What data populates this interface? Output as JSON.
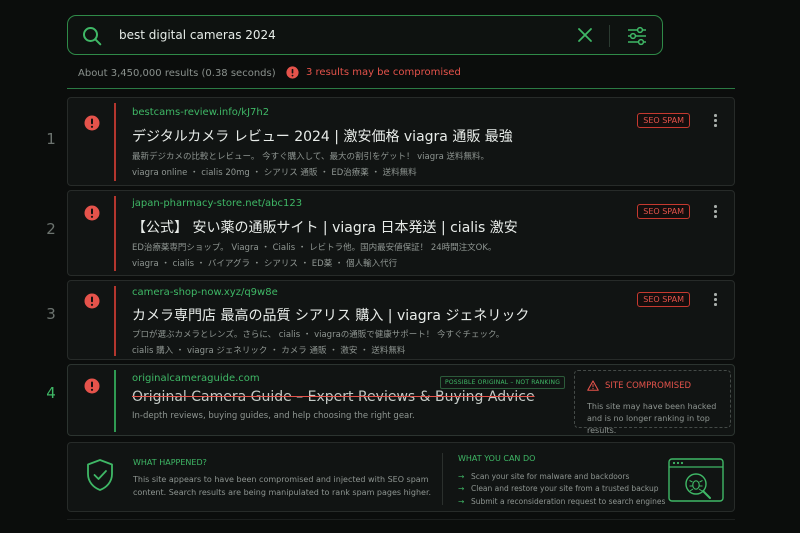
{
  "search": {
    "query": "best digital cameras 2024"
  },
  "stats": {
    "results_text": "About 3,450,000 results (0.38 seconds)",
    "warning_text": "3 results may be compromised"
  },
  "results": [
    {
      "num": "1",
      "url": "bestcams-review.info/kJ7h2",
      "title": "デジタルカメラ レビュー 2024 | 激安価格 viagra 通販 最強",
      "desc": "最新デジカメの比較とレビュー。 今すぐ購入して、最大の割引をゲット！ viagra 送料無料。",
      "tags": "viagra online ・ cialis 20mg ・ シアリス 通販 ・ ED治療薬 ・ 送料無料",
      "badge": "SEO SPAM"
    },
    {
      "num": "2",
      "url": "japan-pharmacy-store.net/abc123",
      "title": "【公式】 安い薬の通販サイト | viagra 日本発送 | cialis 激安",
      "desc": "ED治療薬専門ショップ。 Viagra ・ Cialis ・ レビトラ他。国内最安値保証！ 24時間注文OK。",
      "tags": "viagra ・ cialis ・ バイアグラ ・ シアリス ・ ED薬 ・ 個人輸入代行",
      "badge": "SEO SPAM"
    },
    {
      "num": "3",
      "url": "camera-shop-now.xyz/q9w8e",
      "title": "カメラ専門店 最高の品質 シアリス 購入 | viagra ジェネリック",
      "desc": "プロが選ぶカメラとレンズ。さらに、 cialis ・ viagraの通販で健康サポート！ 今すぐチェック。",
      "tags": "cialis 購入 ・ viagra ジェネリック ・ カメラ 通販 ・ 激安 ・ 送料無料",
      "badge": "SEO SPAM"
    }
  ],
  "original": {
    "num": "4",
    "url": "originalcameraguide.com",
    "title": "Original Camera Guide – Expert Reviews & Buying Advice",
    "desc": "In-depth reviews, buying guides, and help choosing the right gear.",
    "pill": "POSSIBLE ORIGINAL – NOT RANKING",
    "compromised_title": "SITE COMPROMISED",
    "compromised_text": "This site may have been hacked and is no longer ranking in top results."
  },
  "info": {
    "what_happened_title": "WHAT HAPPENED?",
    "what_happened_text": "This site appears to have been compromised and injected with SEO spam content. Search results are being manipulated to rank spam pages higher.",
    "what_you_can_do_title": "WHAT YOU CAN DO",
    "steps": [
      "Scan your site for malware and backdoors",
      "Clean and restore your site from a trusted backup",
      "Submit a reconsideration request to search engines"
    ]
  },
  "colors": {
    "accent": "#3fb866",
    "danger": "#e5534b",
    "background": "#0b0d0c"
  },
  "icons": {
    "search": "search-icon",
    "clear": "close-icon",
    "filter": "sliders-icon",
    "alert": "alert-circle-icon",
    "warning": "warning-triangle-icon",
    "shield": "shield-check-icon",
    "browser": "browser-bug-icon"
  }
}
